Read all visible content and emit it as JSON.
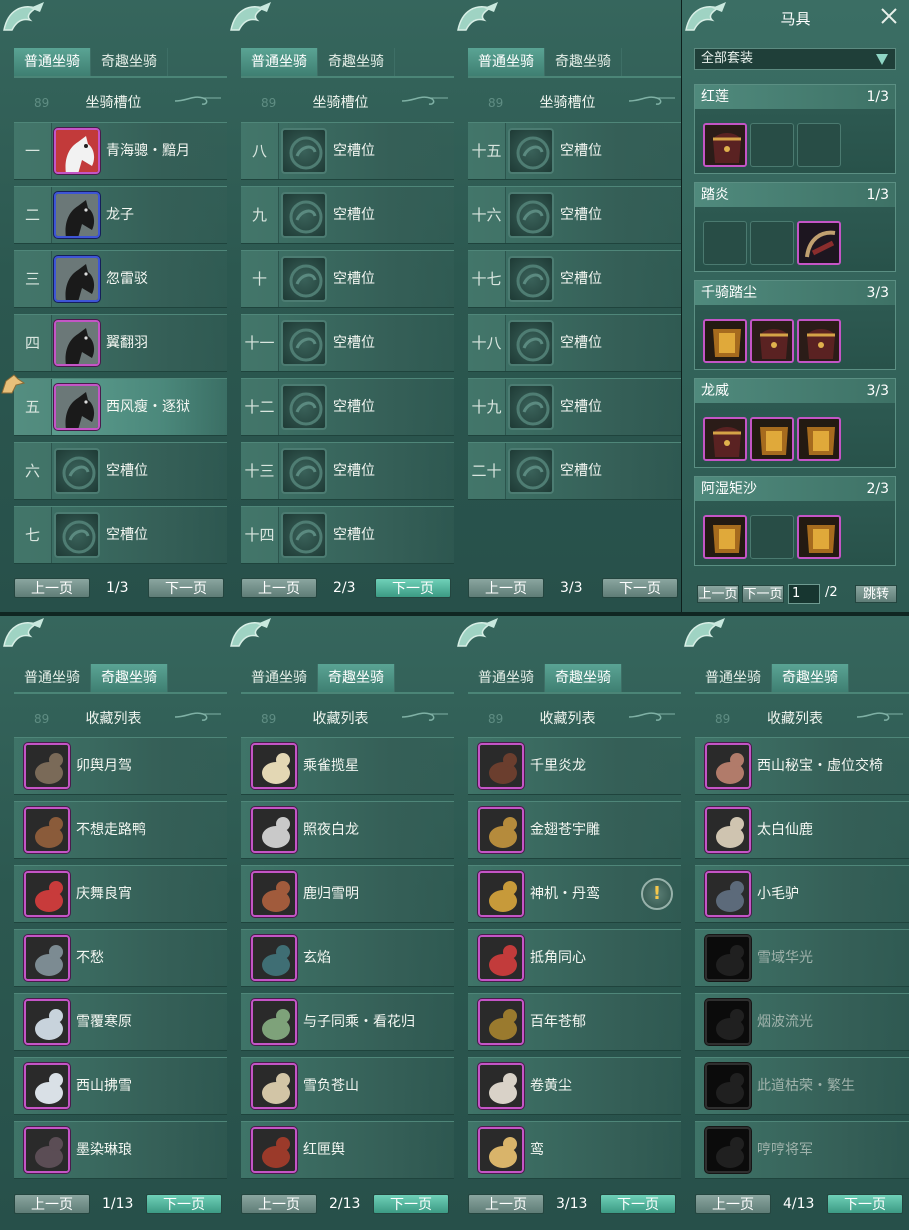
{
  "tabs": {
    "normal": "普通坐骑",
    "fun": "奇趣坐骑"
  },
  "slot_title": "坐骑槽位",
  "collect_title": "收藏列表",
  "faded_num": "89",
  "prev": "上一页",
  "next": "下一页",
  "slot_panels": [
    {
      "page": "1/3",
      "rows": [
        {
          "idx": "一",
          "name": "青海骢・黯月",
          "icon": "horse-white-icon",
          "frame": "pur"
        },
        {
          "idx": "二",
          "name": "龙子",
          "icon": "horse-black-icon",
          "frame": "blu"
        },
        {
          "idx": "三",
          "name": "忽雷驳",
          "icon": "horse-black-icon",
          "frame": "blu"
        },
        {
          "idx": "四",
          "name": "翼翻羽",
          "icon": "horse-black-icon",
          "frame": "pur"
        },
        {
          "idx": "五",
          "name": "西风瘦・逐狱",
          "icon": "horse-black-icon",
          "frame": "pur",
          "selected": true
        },
        {
          "idx": "六",
          "name": "空槽位",
          "icon": "empty-slot-icon",
          "frame": "empty"
        },
        {
          "idx": "七",
          "name": "空槽位",
          "icon": "empty-slot-icon",
          "frame": "empty"
        }
      ]
    },
    {
      "page": "2/3",
      "rows": [
        {
          "idx": "八",
          "name": "空槽位",
          "icon": "empty-slot-icon",
          "frame": "empty"
        },
        {
          "idx": "九",
          "name": "空槽位",
          "icon": "empty-slot-icon",
          "frame": "empty"
        },
        {
          "idx": "十",
          "name": "空槽位",
          "icon": "empty-slot-icon",
          "frame": "empty"
        },
        {
          "idx": "十一",
          "name": "空槽位",
          "icon": "empty-slot-icon",
          "frame": "empty"
        },
        {
          "idx": "十二",
          "name": "空槽位",
          "icon": "empty-slot-icon",
          "frame": "empty"
        },
        {
          "idx": "十三",
          "name": "空槽位",
          "icon": "empty-slot-icon",
          "frame": "empty"
        },
        {
          "idx": "十四",
          "name": "空槽位",
          "icon": "empty-slot-icon",
          "frame": "empty"
        }
      ]
    },
    {
      "page": "3/3",
      "rows": [
        {
          "idx": "十五",
          "name": "空槽位",
          "icon": "empty-slot-icon",
          "frame": "empty"
        },
        {
          "idx": "十六",
          "name": "空槽位",
          "icon": "empty-slot-icon",
          "frame": "empty"
        },
        {
          "idx": "十七",
          "name": "空槽位",
          "icon": "empty-slot-icon",
          "frame": "empty"
        },
        {
          "idx": "十八",
          "name": "空槽位",
          "icon": "empty-slot-icon",
          "frame": "empty"
        },
        {
          "idx": "十九",
          "name": "空槽位",
          "icon": "empty-slot-icon",
          "frame": "empty"
        },
        {
          "idx": "二十",
          "name": "空槽位",
          "icon": "empty-slot-icon",
          "frame": "empty"
        }
      ]
    }
  ],
  "collect_panels": [
    {
      "page": "1/13",
      "rows": [
        {
          "name": "卯舆月驾",
          "icon": "moon-carriage-icon",
          "color": "#7a6a58"
        },
        {
          "name": "不想走路鸭",
          "icon": "duck-icon",
          "color": "#8a5b3a"
        },
        {
          "name": "庆舞良宵",
          "icon": "lion-dance-icon",
          "color": "#c83b3b"
        },
        {
          "name": "不愁",
          "icon": "bird-icon",
          "color": "#7c8b92"
        },
        {
          "name": "雪覆寒原",
          "icon": "white-deer-icon",
          "color": "#c8d3dc"
        },
        {
          "name": "西山拂雪",
          "icon": "white-deer-icon",
          "color": "#d9e0e6"
        },
        {
          "name": "墨染琳琅",
          "icon": "ink-lion-icon",
          "color": "#5b4d55"
        }
      ]
    },
    {
      "page": "2/13",
      "rows": [
        {
          "name": "乘雀揽星",
          "icon": "lotus-icon",
          "color": "#e3d7b4"
        },
        {
          "name": "照夜白龙",
          "icon": "white-dragon-horse-icon",
          "color": "#c9c9c9"
        },
        {
          "name": "鹿归雪明",
          "icon": "deer-cart-icon",
          "color": "#a15b3c"
        },
        {
          "name": "玄焰",
          "icon": "dark-beast-icon",
          "color": "#3f6e74"
        },
        {
          "name": "与子同乘・看花归",
          "icon": "flower-horse-icon",
          "color": "#7ea27a"
        },
        {
          "name": "雪负苍山",
          "icon": "ox-icon",
          "color": "#d2c5a6"
        },
        {
          "name": "红匣舆",
          "icon": "red-box-icon",
          "color": "#9b3a2a"
        }
      ]
    },
    {
      "page": "3/13",
      "rows": [
        {
          "name": "千里炎龙",
          "icon": "fire-horse-icon",
          "color": "#6b3e2e"
        },
        {
          "name": "金翅苍宇雕",
          "icon": "eagle-icon",
          "color": "#b58b3c"
        },
        {
          "name": "神机・丹鸾",
          "icon": "mech-bird-icon",
          "color": "#c79a3a",
          "warn": true
        },
        {
          "name": "抵角同心",
          "icon": "twin-beast-icon",
          "color": "#c23b3b"
        },
        {
          "name": "百年苍郁",
          "icon": "tree-beast-icon",
          "color": "#9a7a2e"
        },
        {
          "name": "卷黄尘",
          "icon": "goose-icon",
          "color": "#d9d2c8"
        },
        {
          "name": "鸾",
          "icon": "phoenix-icon",
          "color": "#d9b46a"
        }
      ]
    },
    {
      "page": "4/13",
      "rows": [
        {
          "name": "西山秘宝・虚位交椅",
          "icon": "lady-portrait-icon",
          "color": "#b17b6a"
        },
        {
          "name": "太白仙鹿",
          "icon": "antler-icon",
          "color": "#cfc4b0"
        },
        {
          "name": "小毛驴",
          "icon": "donkey-icon",
          "color": "#5c6a7a"
        },
        {
          "name": "雪域华光",
          "icon": "deer-silhouette-icon",
          "color": "#444",
          "locked": true
        },
        {
          "name": "烟波流光",
          "icon": "locked-mount-icon",
          "color": "#444",
          "locked": true
        },
        {
          "name": "此道枯荣・繁生",
          "icon": "locked-deer-icon",
          "color": "#444",
          "locked": true
        },
        {
          "name": "哼哼将军",
          "icon": "pig-icon",
          "color": "#444",
          "locked": true
        }
      ]
    }
  ],
  "tack": {
    "title": "马具",
    "filter": "全部套装",
    "sets": [
      {
        "name": "红莲",
        "count": "1/3",
        "slots": [
          "saddle-icon",
          "",
          ""
        ]
      },
      {
        "name": "踏炎",
        "count": "1/3",
        "slots": [
          "",
          "",
          "bridle-icon"
        ]
      },
      {
        "name": "千骑踏尘",
        "count": "3/3",
        "slots": [
          "armor-icon",
          "saddle-icon",
          "saddle-icon"
        ]
      },
      {
        "name": "龙威",
        "count": "3/3",
        "slots": [
          "saddle-icon",
          "armor-icon",
          "armor-icon"
        ]
      },
      {
        "name": "阿湿矩沙",
        "count": "2/3",
        "slots": [
          "armor-icon",
          "",
          "armor-icon"
        ]
      }
    ],
    "prev": "上一页",
    "next": "下一页",
    "page_input": "1",
    "total": "/2",
    "jump": "跳转"
  }
}
